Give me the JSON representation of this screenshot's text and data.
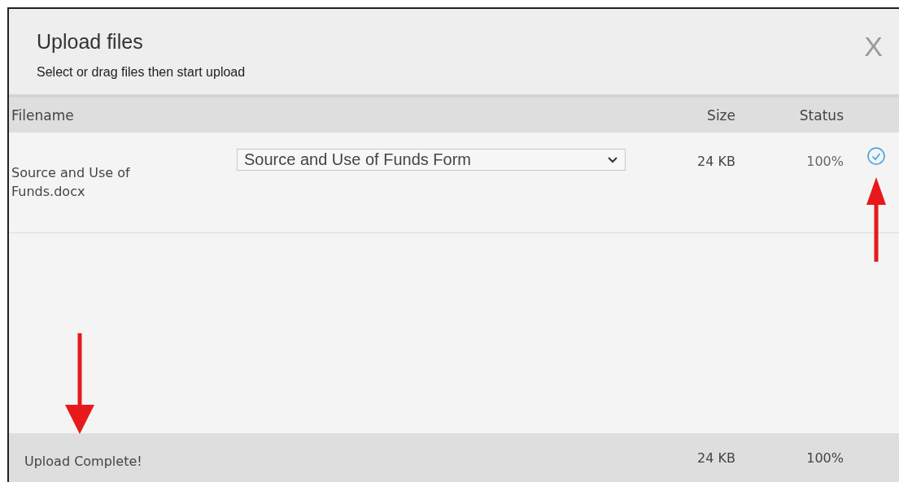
{
  "dialog": {
    "title": "Upload files",
    "subtitle": "Select or drag files then start upload",
    "close": "X"
  },
  "table": {
    "columns": [
      "Filename",
      "Size",
      "Status"
    ],
    "rows": [
      {
        "filename": "Source and Use of Funds.docx",
        "document_type": "Source and Use of Funds Form",
        "size": "24 KB",
        "status": "100%",
        "complete": true
      }
    ]
  },
  "footer": {
    "message": "Upload Complete!",
    "size": "24 KB",
    "status": "100%"
  }
}
